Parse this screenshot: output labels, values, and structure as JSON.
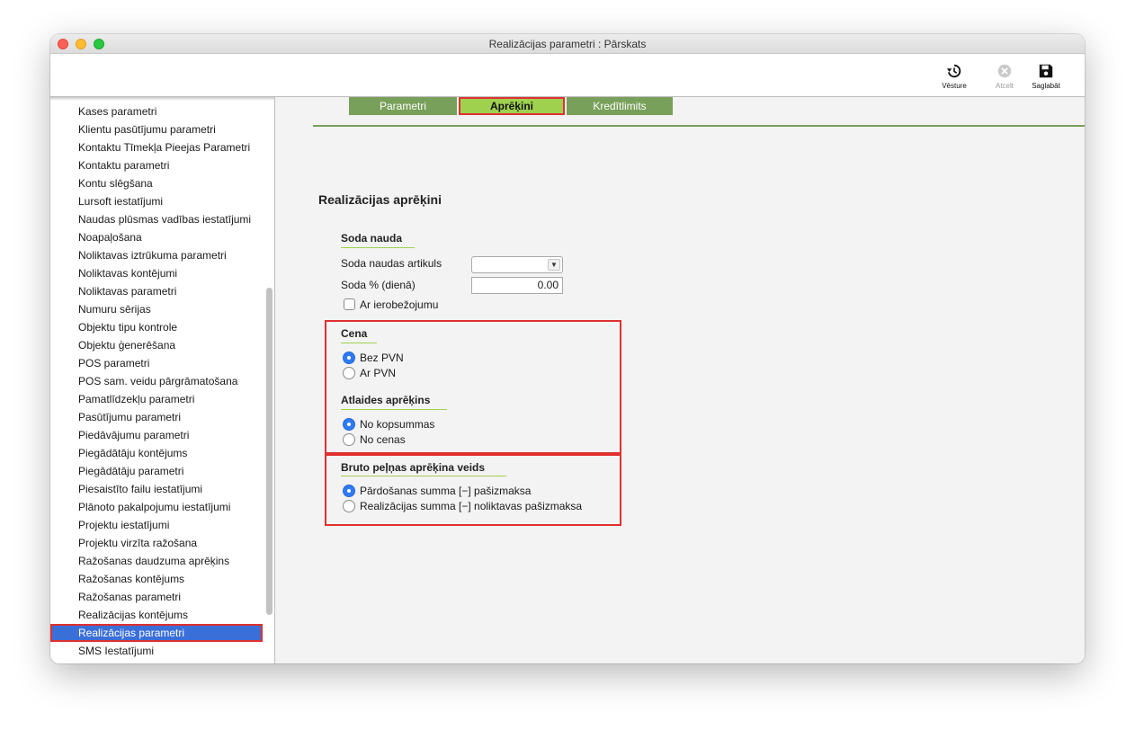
{
  "window": {
    "title": "Realizācijas parametri : Pārskats"
  },
  "toolbar": {
    "history_label": "Vēsture",
    "cancel_label": "Atcelt",
    "save_label": "Saglabāt"
  },
  "sidebar": {
    "items": [
      "Kases parametri",
      "Klientu pasūtījumu parametri",
      "Kontaktu Tīmekļa Pieejas Parametri",
      "Kontaktu parametri",
      "Kontu slēgšana",
      "Lursoft iestatījumi",
      "Naudas plūsmas vadības iestatījumi",
      "Noapaļošana",
      "Noliktavas iztrūkuma parametri",
      "Noliktavas kontējumi",
      "Noliktavas parametri",
      "Numuru sērijas",
      "Objektu tipu kontrole",
      "Objektu ģenerēšana",
      "POS parametri",
      "POS sam. veidu pārgrāmatošana",
      "Pamatlīdzekļu parametri",
      "Pasūtījumu parametri",
      "Piedāvājumu parametri",
      "Piegādātāju kontējums",
      "Piegādātāju parametri",
      "Piesaistīto failu iestatījumi",
      "Plānoto pakalpojumu iestatījumi",
      "Projektu iestatījumi",
      "Projektu virzīta ražošana",
      "Ražošanas daudzuma aprēķins",
      "Ražošanas kontējums",
      "Ražošanas parametri",
      "Realizācijas kontējums",
      "Realizācijas parametri",
      "SMS Iestatījumi"
    ],
    "selected": "Realizācijas parametri"
  },
  "tabs": [
    {
      "label": "Parametri"
    },
    {
      "label": "Aprēķini"
    },
    {
      "label": "Kredītlimits"
    }
  ],
  "main": {
    "section_title": "Realizācijas aprēķini",
    "penalty": {
      "heading": "Soda nauda",
      "article_label": "Soda naudas artikuls",
      "article_value": "",
      "percent_label": "Soda % (dienā)",
      "percent_value": "0.00",
      "limit_label": "Ar ierobežojumu"
    },
    "price": {
      "heading": "Cena",
      "options": [
        "Bez PVN",
        "Ar PVN"
      ],
      "selected": "Bez PVN"
    },
    "discount": {
      "heading": "Atlaides aprēķins",
      "options": [
        "No kopsummas",
        "No cenas"
      ],
      "selected": "No kopsummas"
    },
    "gross_profit": {
      "heading": "Bruto peļņas aprēķina veids",
      "options": [
        "Pārdošanas summa [−] pašizmaksa",
        "Realizācijas summa [−] noliktavas pašizmaksa"
      ],
      "selected": "Pārdošanas summa [−] pašizmaksa"
    }
  },
  "colors": {
    "tab_bg": "#78a05a",
    "tab_active_bg": "#9fd14f",
    "highlight_red": "#e03030",
    "selection_blue": "#3b6fd8",
    "radio_blue": "#2f7bf6"
  }
}
